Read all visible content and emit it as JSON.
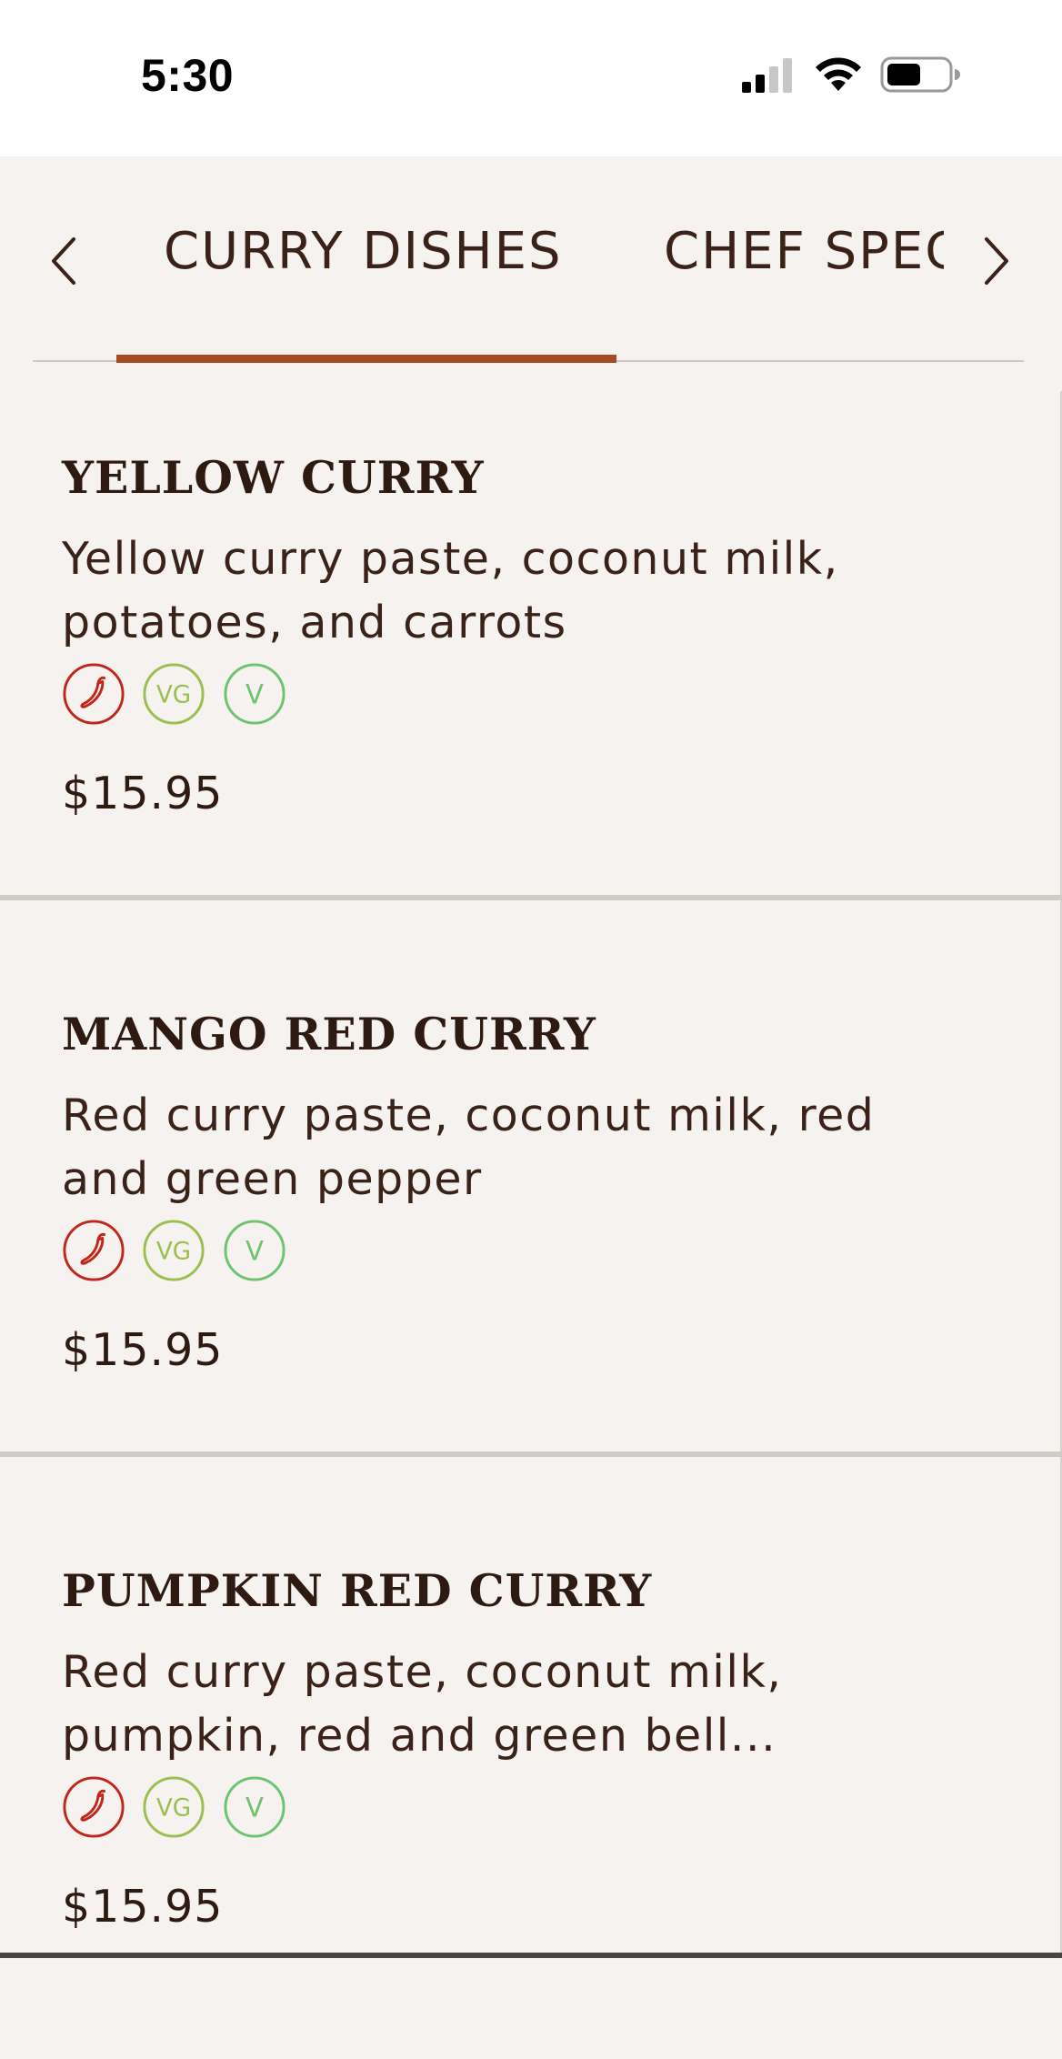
{
  "status_bar": {
    "time": "5:30"
  },
  "tabs": {
    "items": [
      {
        "label": "CURRY DISHES",
        "active": true
      },
      {
        "label": "CHEF SPECIALS",
        "active": false
      }
    ]
  },
  "badge_labels": {
    "vegan": "VG",
    "vegetarian": "V"
  },
  "colors": {
    "accent": "#a64a24",
    "spicy": "#c0261a",
    "vegan": "#9bbf4e",
    "vegetarian": "#6ec46e",
    "background": "#f6f2ef",
    "text": "#2f1a12"
  },
  "menu_items": [
    {
      "name": "YELLOW CURRY",
      "description": "Yellow curry paste, coconut milk, potatoes, and carrots",
      "price": "$15.95",
      "tags": [
        "spicy-icon",
        "vegan-icon",
        "vegetarian-icon"
      ]
    },
    {
      "name": "MANGO RED CURRY",
      "description": "Red curry paste, coconut milk, red and green pepper",
      "price": "$15.95",
      "tags": [
        "spicy-icon",
        "vegan-icon",
        "vegetarian-icon"
      ]
    },
    {
      "name": "PUMPKIN RED CURRY",
      "description": "Red curry paste, coconut milk, pumpkin, red and green bell...",
      "price": "$15.95",
      "tags": [
        "spicy-icon",
        "vegan-icon",
        "vegetarian-icon"
      ]
    }
  ]
}
